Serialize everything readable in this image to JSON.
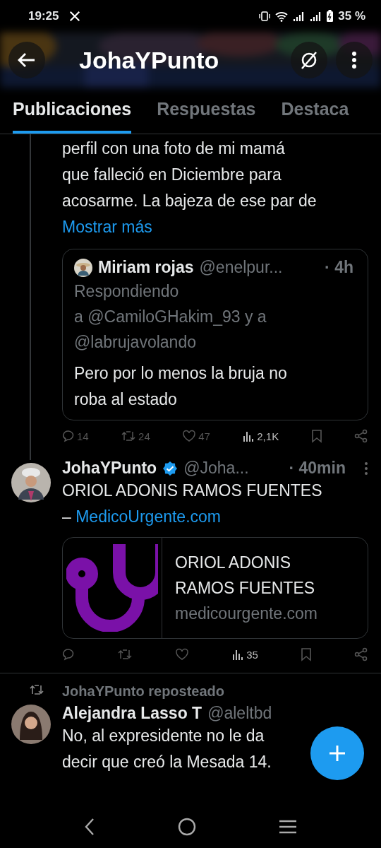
{
  "status_bar": {
    "time": "19:25",
    "battery": "35 %"
  },
  "header": {
    "title": "JohaYPunto"
  },
  "tabs": [
    {
      "label": "Publicaciones",
      "selected": true
    },
    {
      "label": "Respuestas",
      "selected": false
    },
    {
      "label": "Destaca",
      "selected": false
    }
  ],
  "posts": [
    {
      "kind": "continued",
      "text": "perfil con una foto de mi mamá\nque falleció en Diciembre para\nacosarme. La bajeza de ese par de",
      "more": "Mostrar más",
      "quote": {
        "name": "Miriam rojas",
        "handle": "@enelpur...",
        "time": "· 4h",
        "replying": "Respondiendo\na @CamiloGHakim_93 y a\n@labrujavolando",
        "text": "Pero por lo menos la bruja no\nroba al estado"
      },
      "actions": {
        "replies": "14",
        "reposts": "24",
        "likes": "47",
        "views": "2,1K"
      }
    },
    {
      "kind": "full",
      "name": "JohaYPunto",
      "verified": true,
      "handle": "@Joha...",
      "time": "· 40min",
      "text": "ORIOL ADONIS RAMOS FUENTES\n–",
      "link": "MedicoUrgente.com",
      "card": {
        "title": "ORIOL ADONIS\nRAMOS FUENTES",
        "domain": "medicourgente.com"
      },
      "actions": {
        "views": "35"
      }
    },
    {
      "kind": "repost",
      "reposted_by": "JohaYPunto reposteado",
      "name": "Alejandra Lasso T",
      "handle": "@aleltbd",
      "text": "No, al expresidente no le da\ndecir que creó la Mesada 14."
    }
  ]
}
